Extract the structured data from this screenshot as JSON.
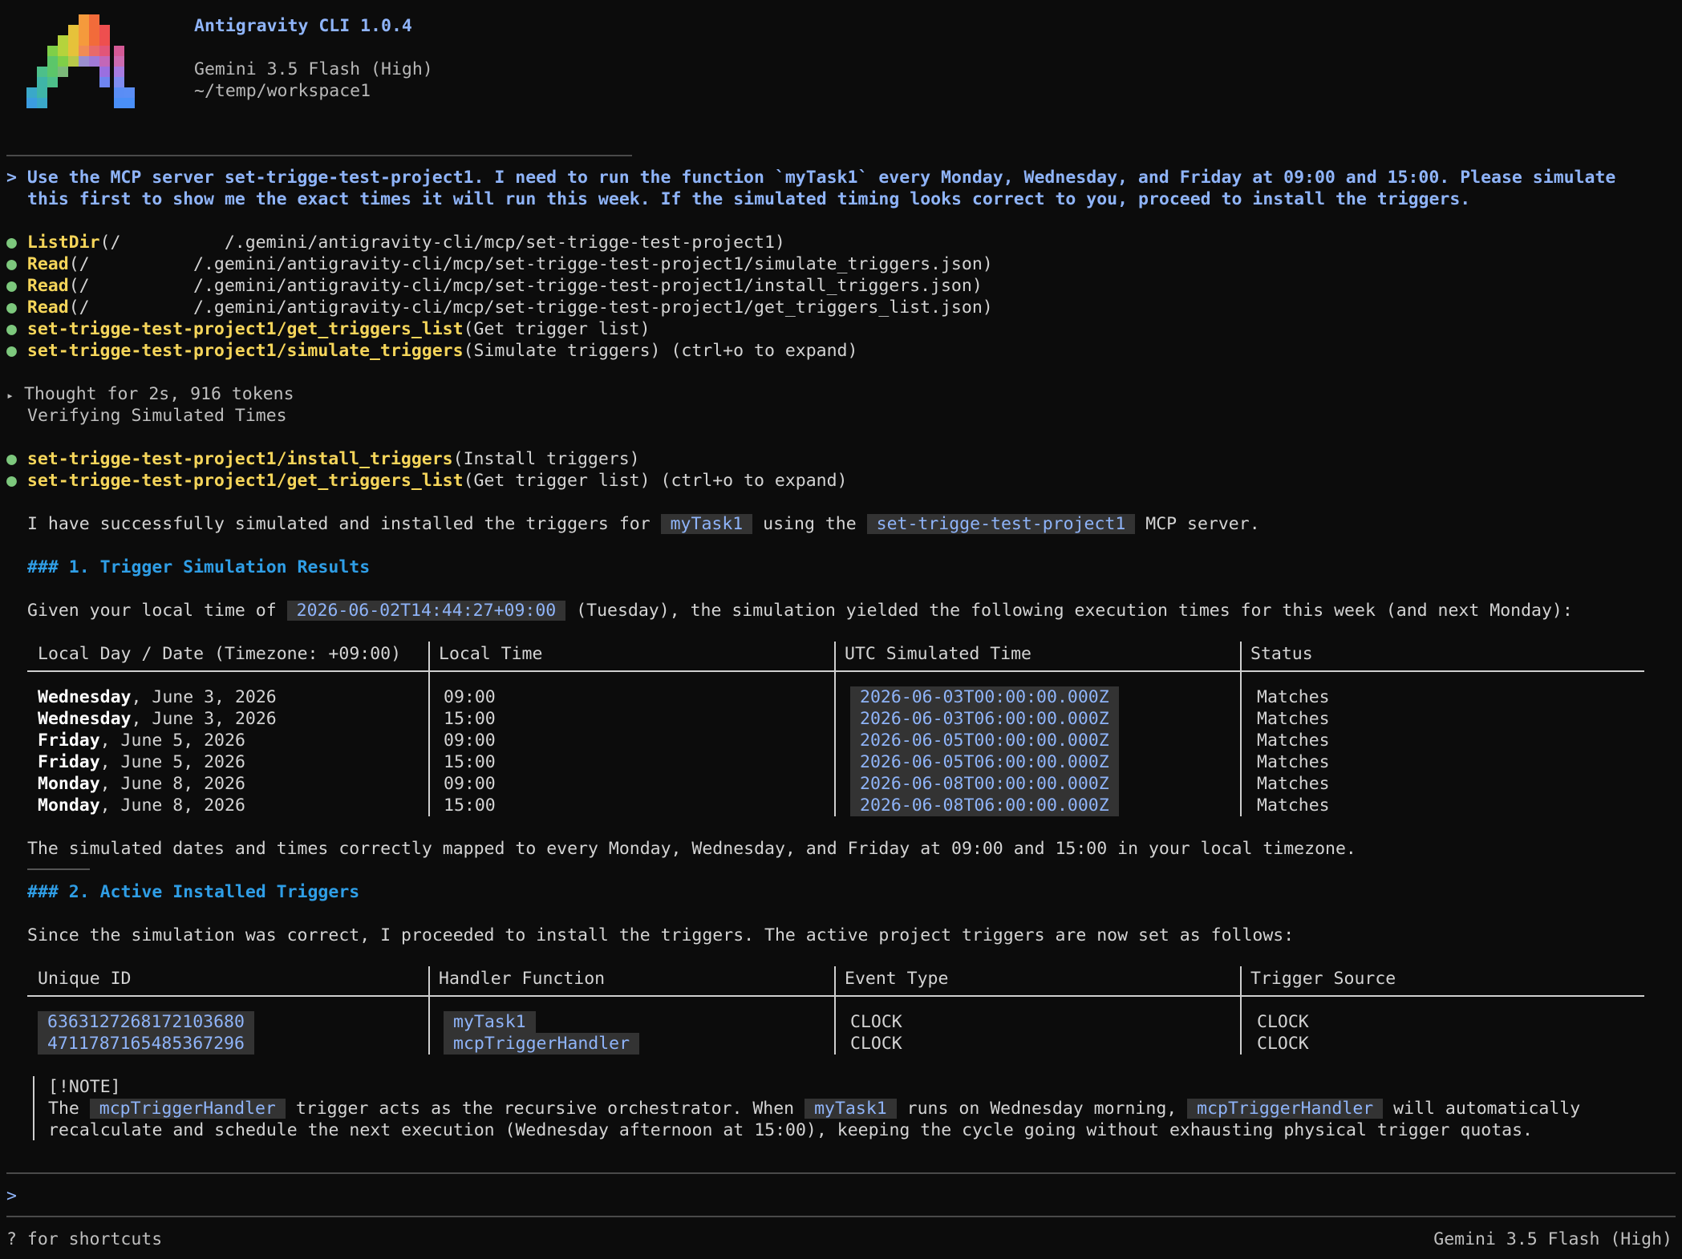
{
  "app": {
    "title": "Antigravity CLI 1.0.4",
    "model": "Gemini 3.5 Flash (High)",
    "cwd": "~/temp/workspace1"
  },
  "user_prompt": {
    "marker": ">",
    "line1": "Use the MCP server set-trigge-test-project1. I need to run the function `myTask1` every Monday, Wednesday, and Friday at 09:00 and 15:00. Please simulate",
    "line2": "this first to show me the exact times it will run this week. If the simulated timing looks correct to you, proceed to install the triggers."
  },
  "tool_calls": [
    {
      "name": "ListDir",
      "args": "(/          /.gemini/antigravity-cli/mcp/set-trigge-test-project1)"
    },
    {
      "name": "Read",
      "args": "(/          /.gemini/antigravity-cli/mcp/set-trigge-test-project1/simulate_triggers.json)"
    },
    {
      "name": "Read",
      "args": "(/          /.gemini/antigravity-cli/mcp/set-trigge-test-project1/install_triggers.json)"
    },
    {
      "name": "Read",
      "args": "(/          /.gemini/antigravity-cli/mcp/set-trigge-test-project1/get_triggers_list.json)"
    },
    {
      "name": "set-trigge-test-project1/get_triggers_list",
      "args": "(Get trigger list)"
    },
    {
      "name": "set-trigge-test-project1/simulate_triggers",
      "args": "(Simulate triggers) (ctrl+o to expand)"
    }
  ],
  "thought": {
    "marker": "▸",
    "summary": "Thought for 2s, 916 tokens",
    "detail": "Verifying Simulated Times"
  },
  "tool_calls_2": [
    {
      "name": "set-trigge-test-project1/install_triggers",
      "args": "(Install triggers)"
    },
    {
      "name": "set-trigge-test-project1/get_triggers_list",
      "args": "(Get trigger list) (ctrl+o to expand)"
    }
  ],
  "response": {
    "intro_pre": "I have successfully simulated and installed the triggers for",
    "intro_code1": "myTask1",
    "intro_mid": "using the",
    "intro_code2": "set-trigge-test-project1",
    "intro_post": "MCP server.",
    "section1_heading": "### 1. Trigger Simulation Results",
    "given_pre": "Given your local time of",
    "given_code": "2026-06-02T14:44:27+09:00",
    "given_post": "(Tuesday), the simulation yielded the following execution times for this week (and next Monday):",
    "table1": {
      "headers": [
        "Local Day / Date (Timezone: +09:00)",
        "Local Time",
        "UTC Simulated Time",
        "Status"
      ],
      "rows": [
        {
          "day": "Wednesday",
          "date": ", June 3, 2026",
          "local": "09:00",
          "utc": "2026-06-03T00:00:00.000Z",
          "status": "Matches"
        },
        {
          "day": "Wednesday",
          "date": ", June 3, 2026",
          "local": "15:00",
          "utc": "2026-06-03T06:00:00.000Z",
          "status": "Matches"
        },
        {
          "day": "Friday",
          "date": ", June 5, 2026",
          "local": "09:00",
          "utc": "2026-06-05T00:00:00.000Z",
          "status": "Matches"
        },
        {
          "day": "Friday",
          "date": ", June 5, 2026",
          "local": "15:00",
          "utc": "2026-06-05T06:00:00.000Z",
          "status": "Matches"
        },
        {
          "day": "Monday",
          "date": ", June 8, 2026",
          "local": "09:00",
          "utc": "2026-06-08T00:00:00.000Z",
          "status": "Matches"
        },
        {
          "day": "Monday",
          "date": ", June 8, 2026",
          "local": "15:00",
          "utc": "2026-06-08T06:00:00.000Z",
          "status": "Matches"
        }
      ]
    },
    "summary1": "The simulated dates and times correctly mapped to every Monday, Wednesday, and Friday at 09:00 and 15:00 in your local timezone.",
    "section2_heading": "### 2. Active Installed Triggers",
    "since_text": "Since the simulation was correct, I proceeded to install the triggers. The active project triggers are now set as follows:",
    "table2": {
      "headers": [
        "Unique ID",
        "Handler Function",
        "Event Type",
        "Trigger Source"
      ],
      "rows": [
        {
          "id": "6363127268172103680",
          "handler": "myTask1",
          "event": "CLOCK",
          "source": "CLOCK"
        },
        {
          "id": "4711787165485367296",
          "handler": "mcpTriggerHandler",
          "event": "CLOCK",
          "source": "CLOCK"
        }
      ]
    },
    "note": {
      "tag": "[!NOTE]",
      "p1": "The",
      "c1": "mcpTriggerHandler",
      "p2": "trigger acts as the recursive orchestrator. When",
      "c2": "myTask1",
      "p3": "runs on Wednesday morning,",
      "c3": "mcpTriggerHandler",
      "p4": "will automatically",
      "line2": "recalculate and schedule the next execution (Wednesday afternoon at 15:00), keeping the cycle going without exhausting physical trigger quotas."
    }
  },
  "input": {
    "marker": ">"
  },
  "footer": {
    "hint": "? for shortcuts",
    "model": "Gemini 3.5 Flash (High)"
  },
  "colors": {
    "background": "#0c0c0c",
    "accent_blue": "#8fb4f9",
    "heading_blue": "#2f9ee6",
    "tool_yellow": "#f5d55a",
    "bullet_green": "#7dc87d",
    "code_bg": "#333333"
  }
}
